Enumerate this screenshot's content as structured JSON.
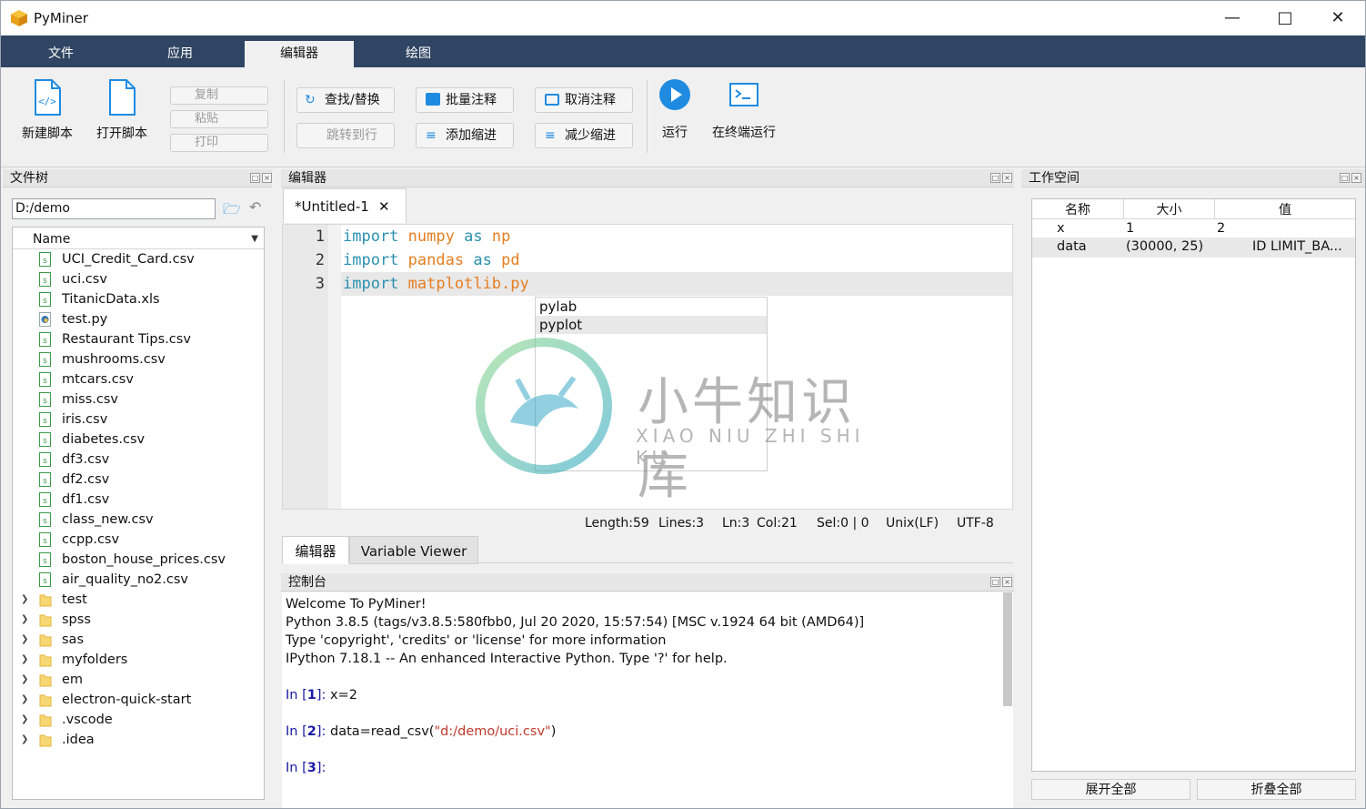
{
  "app": {
    "title": "PyMiner"
  },
  "ribbon": {
    "tabs": [
      "文件",
      "应用",
      "编辑器",
      "绘图"
    ],
    "active_tab": "编辑器"
  },
  "toolbar": {
    "new_script": "新建脚本",
    "open_script": "打开脚本",
    "copy": "复制",
    "paste": "粘贴",
    "print": "打印",
    "find_replace": "查找/替换",
    "goto_line": "跳转到行",
    "batch_comment": "批量注释",
    "add_indent": "添加缩进",
    "uncomment": "取消注释",
    "reduce_indent": "减少缩进",
    "run": "运行",
    "run_in_terminal": "在终端运行"
  },
  "file_tree": {
    "title": "文件树",
    "path": "D:/demo",
    "column": "Name",
    "files": [
      "UCI_Credit_Card.csv",
      "uci.csv",
      "TitanicData.xls",
      "test.py",
      "Restaurant Tips.csv",
      "mushrooms.csv",
      "mtcars.csv",
      "miss.csv",
      "iris.csv",
      "diabetes.csv",
      "df3.csv",
      "df2.csv",
      "df1.csv",
      "class_new.csv",
      "ccpp.csv",
      "boston_house_prices.csv",
      "air_quality_no2.csv"
    ],
    "folders": [
      "test",
      "spss",
      "sas",
      "myfolders",
      "em",
      "electron-quick-start",
      ".vscode",
      ".idea"
    ]
  },
  "editor": {
    "title": "编辑器",
    "tab": "*Untitled-1",
    "lines": [
      {
        "n": "1",
        "kw": "import",
        "rest": " numpy as np",
        "parts": [
          "import",
          " ",
          "numpy",
          " ",
          "as",
          " ",
          "np"
        ]
      },
      {
        "n": "2",
        "kw": "import",
        "rest": " pandas as pd",
        "parts": [
          "import",
          " ",
          "pandas",
          " ",
          "as",
          " ",
          "pd"
        ]
      },
      {
        "n": "3",
        "kw": "import",
        "rest": " matplotlib.py",
        "parts": [
          "import",
          " ",
          "matplotlib.py"
        ]
      }
    ],
    "autocomplete": [
      "pylab",
      "pyplot"
    ],
    "status": {
      "length": "Length:59",
      "lines": "Lines:3",
      "ln": "Ln:3",
      "col": "Col:21",
      "sel": "Sel:0 | 0",
      "eol": "Unix(LF)",
      "enc": "UTF-8"
    },
    "bottom_tabs": [
      "编辑器",
      "Variable Viewer"
    ]
  },
  "console": {
    "title": "控制台",
    "banner": [
      "Welcome To PyMiner!",
      "Python 3.8.5 (tags/v3.8.5:580fbb0, Jul 20 2020, 15:57:54) [MSC v.1924 64 bit (AMD64)]",
      "Type 'copyright', 'credits' or 'license' for more information",
      "IPython 7.18.1 -- An enhanced Interactive Python. Type '?' for help."
    ],
    "prompts": [
      {
        "label": "In [",
        "num": "1",
        "close": "]: ",
        "code": "x=2",
        "str": "",
        "tail": ""
      },
      {
        "label": "In [",
        "num": "2",
        "close": "]: ",
        "code": "data=read_csv(",
        "str": "\"d:/demo/uci.csv\"",
        "tail": ")"
      },
      {
        "label": "In [",
        "num": "3",
        "close": "]: ",
        "code": "",
        "str": "",
        "tail": ""
      }
    ]
  },
  "workspace": {
    "title": "工作空间",
    "columns": [
      "名称",
      "大小",
      "值"
    ],
    "rows": [
      [
        "x",
        "1",
        "2"
      ],
      [
        "data",
        "(30000, 25)",
        "ID  LIMIT_BA..."
      ]
    ],
    "expand_all": "展开全部",
    "collapse_all": "折叠全部"
  },
  "watermark": {
    "cn": "小牛知识库",
    "en": "XIAO NIU ZHI SHI KU"
  },
  "colors": {
    "ribbon": "#2f4563",
    "keyword": "#2b91af",
    "identifier": "#e67e22",
    "prompt": "#1a1aa6",
    "string": "#c0392b"
  }
}
